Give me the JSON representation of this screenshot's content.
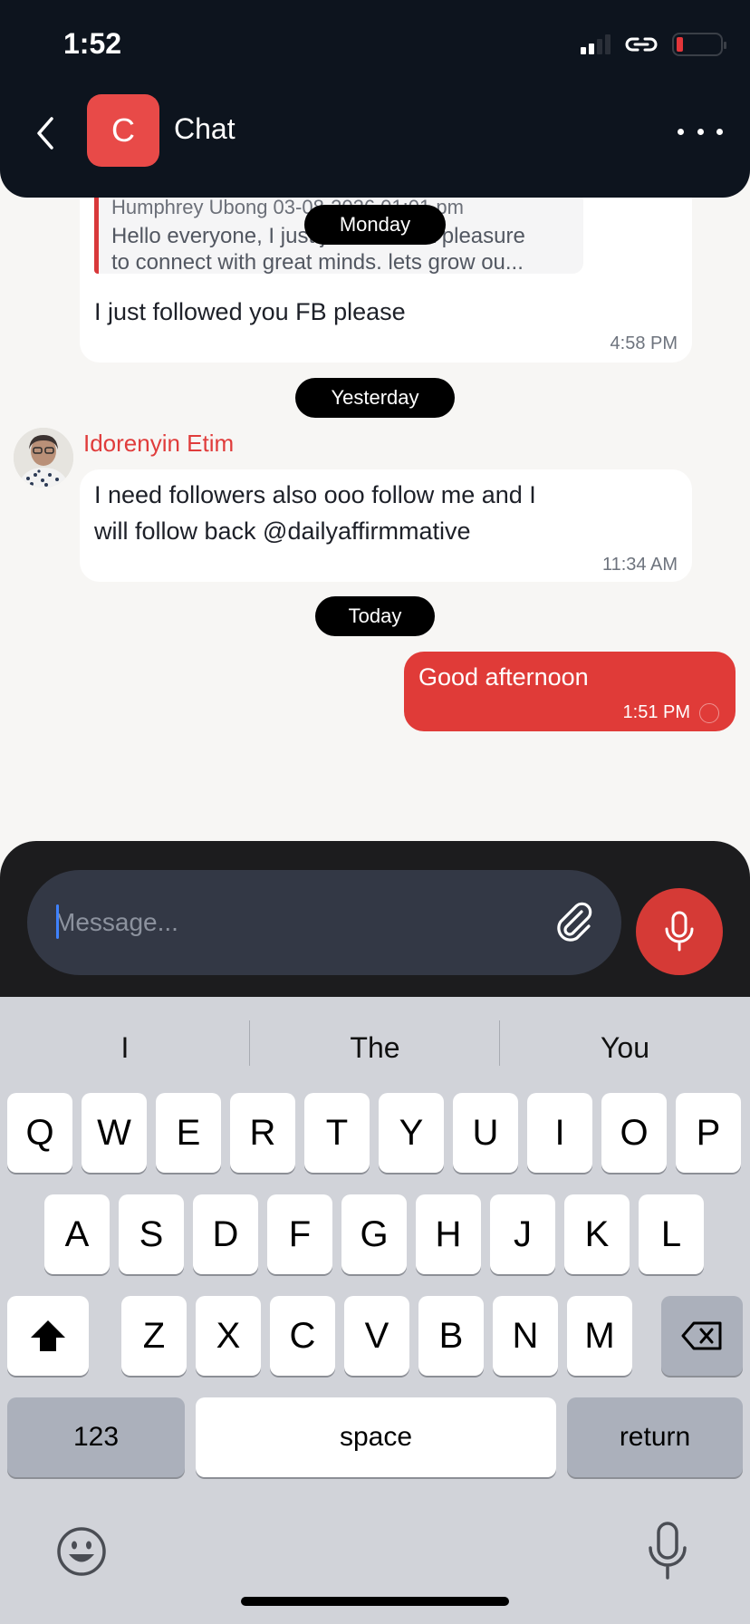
{
  "status": {
    "time": "1:52"
  },
  "header": {
    "avatar_letter": "C",
    "title": "Chat"
  },
  "messages": {
    "reply": {
      "meta": "Humphrey Ubong 03-08-2026 01:01 pm",
      "text_line1": "Hello everyone, I just joined. It's a pleasure",
      "text_line2": "to connect with great minds.  lets grow ou..."
    },
    "msg1": {
      "text": "I just followed you FB please",
      "time": "4:58 PM"
    },
    "day_monday": "Monday",
    "day_yesterday": "Yesterday",
    "msg2": {
      "sender": "Idorenyin Etim",
      "line1": "I need followers  also ooo follow me and I",
      "line2": "will follow back @dailyaffirmmative",
      "time": "11:34 AM"
    },
    "day_today": "Today",
    "msg3": {
      "text": "Good afternoon",
      "time": "1:51 PM"
    }
  },
  "composer": {
    "placeholder": "Message..."
  },
  "keyboard": {
    "suggestions": [
      "I",
      "The",
      "You"
    ],
    "row1": [
      "Q",
      "W",
      "E",
      "R",
      "T",
      "Y",
      "U",
      "I",
      "O",
      "P"
    ],
    "row2": [
      "A",
      "S",
      "D",
      "F",
      "G",
      "H",
      "J",
      "K",
      "L"
    ],
    "row3": [
      "Z",
      "X",
      "C",
      "V",
      "B",
      "N",
      "M"
    ],
    "numbers": "123",
    "space": "space",
    "return": "return"
  },
  "icons": {
    "back": "chevron-left-icon",
    "more": "ellipsis-icon",
    "attach": "paperclip-icon",
    "mic": "microphone-icon",
    "shift": "shift-icon",
    "delete": "backspace-icon",
    "emoji": "emoji-icon",
    "dictation": "dictation-mic-icon"
  },
  "colors": {
    "header_bg": "#0d141e",
    "accent_red": "#e03b38",
    "sender_name": "#e03c3b",
    "composer_bg": "#1c1c1e",
    "keyboard_bg": "#d1d3d9"
  }
}
